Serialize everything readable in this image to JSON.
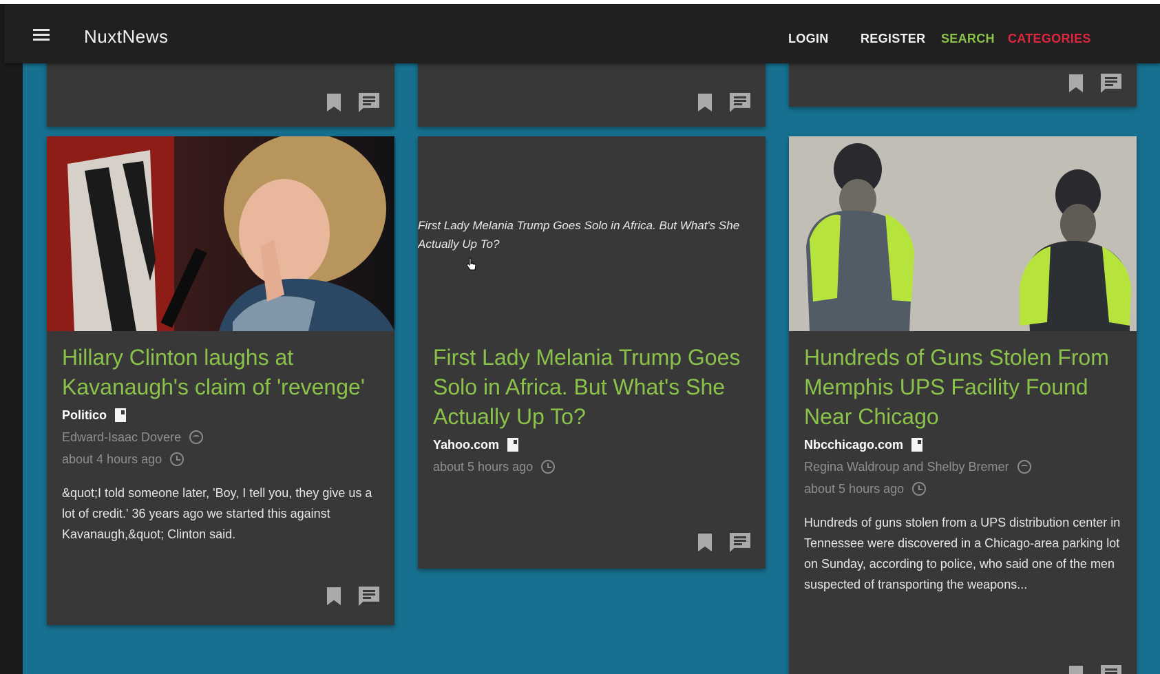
{
  "app": {
    "title": "NuxtNews",
    "nav": {
      "login": "LOGIN",
      "register": "REGISTER",
      "search": "SEARCH",
      "categories": "CATEGORIES"
    }
  },
  "colors": {
    "toolbar": "#202020",
    "background": "#17708f",
    "card": "#383838",
    "title_green": "#8bc34a",
    "search": "#8bc34a",
    "categories": "#e0263f"
  },
  "icons": {
    "menu": "hamburger-icon",
    "bookmark": "bookmark-icon",
    "comment": "comment-icon",
    "source": "document-icon",
    "author": "face-icon",
    "time": "alarm-clock-icon"
  },
  "cards": [
    {
      "title": "Hillary Clinton laughs at Kavanaugh's claim of 'revenge'",
      "source": "Politico",
      "author": "Edward-Isaac Dovere",
      "time": "about 4 hours ago",
      "description": "&quot;I told someone later, 'Boy, I tell you, they give us a lot of credit.' 36 years ago we started this against Kavanaugh,&quot; Clinton said."
    },
    {
      "title": "First Lady Melania Trump Goes Solo in Africa. But What's She Actually Up To?",
      "image_alt": "First Lady Melania Trump Goes Solo in Africa. But What's She Actually Up To?",
      "source": "Yahoo.com",
      "time": "about 5 hours ago"
    },
    {
      "title": "Hundreds of Guns Stolen From Memphis UPS Facility Found Near Chicago",
      "source": "Nbcchicago.com",
      "author": "Regina Waldroup and Shelby Bremer",
      "time": "about 5 hours ago",
      "description": "Hundreds of guns stolen from a UPS distribution center in Tennessee were discovered in a Chicago-area parking lot on Sunday, according to police, who said one of the men suspected of transporting the weapons..."
    }
  ]
}
